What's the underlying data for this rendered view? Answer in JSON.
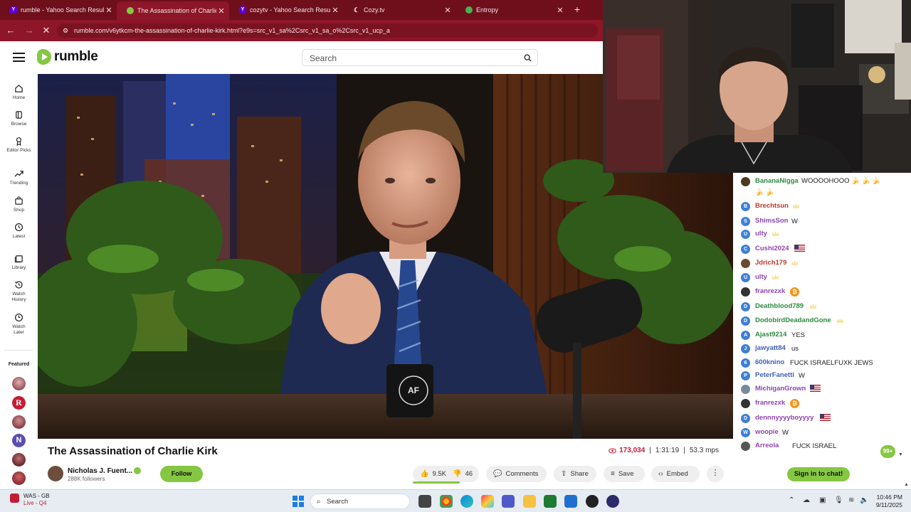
{
  "browser": {
    "tabs": [
      {
        "title": "rumble - Yahoo Search Results",
        "fav": "Y",
        "fav_color": "#6001d2"
      },
      {
        "title": "The Assassination of Charlie Kirk",
        "fav": "",
        "fav_color": "#85c742"
      },
      {
        "title": "cozytv - Yahoo Search Results",
        "fav": "Y",
        "fav_color": "#6001d2"
      },
      {
        "title": "Cozy.tv",
        "fav": "",
        "fav_color": "#ffffff"
      },
      {
        "title": "Entropy",
        "fav": "",
        "fav_color": "#4caf50"
      }
    ],
    "new_tab": "+",
    "url": "rumble.com/v6ytkcm-the-assassination-of-charlie-kirk.html?e9s=src_v1_sa%2Csrc_v1_sa_o%2Csrc_v1_ucp_a",
    "accent": "#8d1628"
  },
  "rumble": {
    "logo": "rumble",
    "search_placeholder": "Search",
    "brand_color": "#85c742",
    "sidebar": [
      {
        "label": "Home",
        "icon": "home-icon"
      },
      {
        "label": "Browse",
        "icon": "browse-icon"
      },
      {
        "label": "Editor Picks",
        "icon": "editor-picks-icon"
      },
      {
        "label": "Trending",
        "icon": "trending-icon"
      },
      {
        "label": "Shop",
        "icon": "shop-icon"
      },
      {
        "label": "Latest",
        "icon": "latest-icon"
      },
      {
        "label": "Library",
        "icon": "library-icon"
      },
      {
        "label": "Watch History",
        "icon": "history-icon"
      },
      {
        "label": "Watch Later",
        "icon": "watch-later-icon"
      }
    ],
    "featured_label": "Featured"
  },
  "video": {
    "title": "The Assassination of Charlie Kirk",
    "views": "173,034",
    "duration": "1:31:19",
    "bitrate": "53.3 mps",
    "separator": "|",
    "channel": "Nicholas J. Fuent...",
    "followers": "288K followers",
    "follow_label": "Follow",
    "likes": "9.5K",
    "dislikes": "46",
    "comments_label": "Comments",
    "share_label": "Share",
    "save_label": "Save",
    "embed_label": "Embed",
    "mug_text": "AF"
  },
  "chat": {
    "messages": [
      {
        "user": "BananaNigga",
        "color": "#2d8a3e",
        "av": "",
        "av_color": "#4a3a20",
        "text": "WOOOOHOOO 🍌 🍌 🍌",
        "cont": "🍌 🍌",
        "extra": ""
      },
      {
        "user": "Brechtsun",
        "color": "#c0392b",
        "av": "B",
        "av_color": "#3f7fd4",
        "text": "",
        "extra": "crown"
      },
      {
        "user": "ShimsSon",
        "color": "#8e44ad",
        "av": "S",
        "av_color": "#3f7fd4",
        "text": "W",
        "extra": ""
      },
      {
        "user": "ulty",
        "color": "#8e44ad",
        "av": "U",
        "av_color": "#3f7fd4",
        "text": "",
        "extra": "crown"
      },
      {
        "user": "Cushi2024",
        "color": "#8e44ad",
        "av": "C",
        "av_color": "#3f7fd4",
        "text": "",
        "extra": "flag"
      },
      {
        "user": "Jdrich179",
        "color": "#c0392b",
        "av": "",
        "av_color": "#6b4b2e",
        "text": "",
        "extra": "crown"
      },
      {
        "user": "ulty",
        "color": "#8e44ad",
        "av": "U",
        "av_color": "#3f7fd4",
        "text": "",
        "extra": "crown"
      },
      {
        "user": "franrezxk",
        "color": "#8e44ad",
        "av": "",
        "av_color": "#333333",
        "text": "",
        "extra": "btc"
      },
      {
        "user": "Deathblood789",
        "color": "#2d8a3e",
        "av": "D",
        "av_color": "#3f7fd4",
        "text": "",
        "extra": "crown"
      },
      {
        "user": "DodobirdDeadandGone",
        "color": "#2d8a3e",
        "av": "D",
        "av_color": "#3f7fd4",
        "text": "",
        "extra": "crown"
      },
      {
        "user": "Ajast9214",
        "color": "#2d8a3e",
        "av": "A",
        "av_color": "#3f7fd4",
        "text": "YES",
        "extra": ""
      },
      {
        "user": "jawyatt84",
        "color": "#3f5fb5",
        "av": "J",
        "av_color": "#3f7fd4",
        "text": "us",
        "extra": ""
      },
      {
        "user": "600knino",
        "color": "#3f5fb5",
        "av": "6",
        "av_color": "#3f7fd4",
        "text": "FUCK ISRAELFUXK JEWS",
        "extra": ""
      },
      {
        "user": "PeterFanetti",
        "color": "#3f5fb5",
        "av": "P",
        "av_color": "#3f7fd4",
        "text": "W",
        "extra": ""
      },
      {
        "user": "MichiganGrown",
        "color": "#8e44ad",
        "av": "",
        "av_color": "#7a8a9a",
        "text": "",
        "extra": "flag"
      },
      {
        "user": "franrezxk",
        "color": "#8e44ad",
        "av": "",
        "av_color": "#333333",
        "text": "",
        "extra": "btc"
      },
      {
        "user": "dennnyyyyboyyyy",
        "color": "#8e44ad",
        "av": "D",
        "av_color": "#3f7fd4",
        "text": "",
        "extra": "flag"
      },
      {
        "user": "woopie",
        "color": "#8e44ad",
        "av": "W",
        "av_color": "#3f7fd4",
        "text": "W",
        "extra": ""
      },
      {
        "user": "Arreola",
        "color": "#8e44ad",
        "av": "",
        "av_color": "#555555",
        "text": "FUCK ISRAEL",
        "extra": ""
      }
    ],
    "unread_badge": "99+",
    "signin_label": "Sign in to chat!"
  },
  "taskbar": {
    "weather_team": "WAS - GB",
    "weather_status": "Live - Q4",
    "search_placeholder": "Search",
    "time": "10:46 PM",
    "date": "9/11/2025"
  }
}
